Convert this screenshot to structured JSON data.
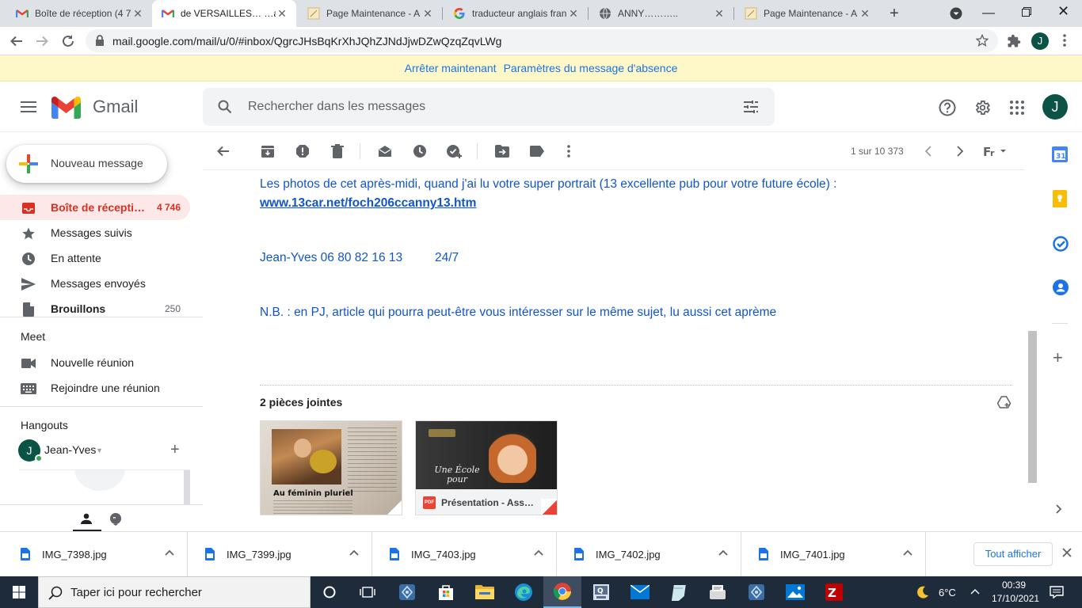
{
  "browser": {
    "tabs": [
      {
        "title": "Boîte de réception (4 7",
        "icon": "gmail-icon"
      },
      {
        "title": "de VERSAILLES… …aus",
        "icon": "gmail-icon",
        "active": true
      },
      {
        "title": "Page Maintenance - A",
        "icon": "page-icon"
      },
      {
        "title": "traducteur anglais fran",
        "icon": "google-icon"
      },
      {
        "title": "ANNY………..",
        "icon": "globe-icon"
      },
      {
        "title": "Page Maintenance - A",
        "icon": "page-icon"
      }
    ],
    "url": "mail.google.com/mail/u/0/#inbox/QgrcJHsBqKrXhJQhZJNdJjwDZwQzqZqvLWg",
    "profile_initial": "J"
  },
  "banner": {
    "stop_label": "Arrêter maintenant",
    "settings_label": "Paramètres du message d'absence"
  },
  "gmail": {
    "logo_text": "Gmail",
    "search_placeholder": "Rechercher dans les messages",
    "avatar_initial": "J",
    "compose_label": "Nouveau message",
    "nav": [
      {
        "label": "Boîte de récepti…",
        "count": "4 746",
        "icon": "inbox-icon",
        "active": true
      },
      {
        "label": "Messages suivis",
        "count": "",
        "icon": "star-icon"
      },
      {
        "label": "En attente",
        "count": "",
        "icon": "clock-icon"
      },
      {
        "label": "Messages envoyés",
        "count": "",
        "icon": "send-icon"
      },
      {
        "label": "Brouillons",
        "count": "250",
        "icon": "draft-icon"
      }
    ],
    "meet": {
      "title": "Meet",
      "new_meeting": "Nouvelle réunion",
      "join_meeting": "Rejoindre une réunion"
    },
    "hangouts": {
      "title": "Hangouts",
      "user_initial": "J",
      "user_name": "Jean-Yves"
    },
    "pagination": "1 sur 10 373"
  },
  "message": {
    "line1": "Les photos de cet après-midi, quand j'ai lu votre super portrait (13 excellente pub pour votre future école) :",
    "link": "www.13car.net/foch206ccanny13.htm",
    "signature_name": "Jean-Yves 06 80 82 16 13",
    "signature_avail": "24/7",
    "nb": "N.B. : en PJ, article qui pourra peut-être vous intéresser sur le même sujet, lu aussi cet aprème",
    "attachments_title": "2 pièces jointes",
    "attachment1_caption": "Au féminin pluriel",
    "attachment2_text": "Une École pour",
    "attachment2_name": "Présentation - Ass…",
    "attachment2_type": "PDF"
  },
  "downloads": {
    "files": [
      "IMG_7398.jpg",
      "IMG_7399.jpg",
      "IMG_7403.jpg",
      "IMG_7402.jpg",
      "IMG_7401.jpg"
    ],
    "show_all": "Tout afficher"
  },
  "taskbar": {
    "search_placeholder": "Taper ici pour rechercher",
    "temperature": "6°C",
    "time": "00:39",
    "date": "17/10/2021"
  },
  "colors": {
    "gmail_red": "#d93025",
    "link_blue": "#1155cc",
    "banner_bg": "#fef7c8",
    "taskbar_bg": "#1e2b3a"
  }
}
